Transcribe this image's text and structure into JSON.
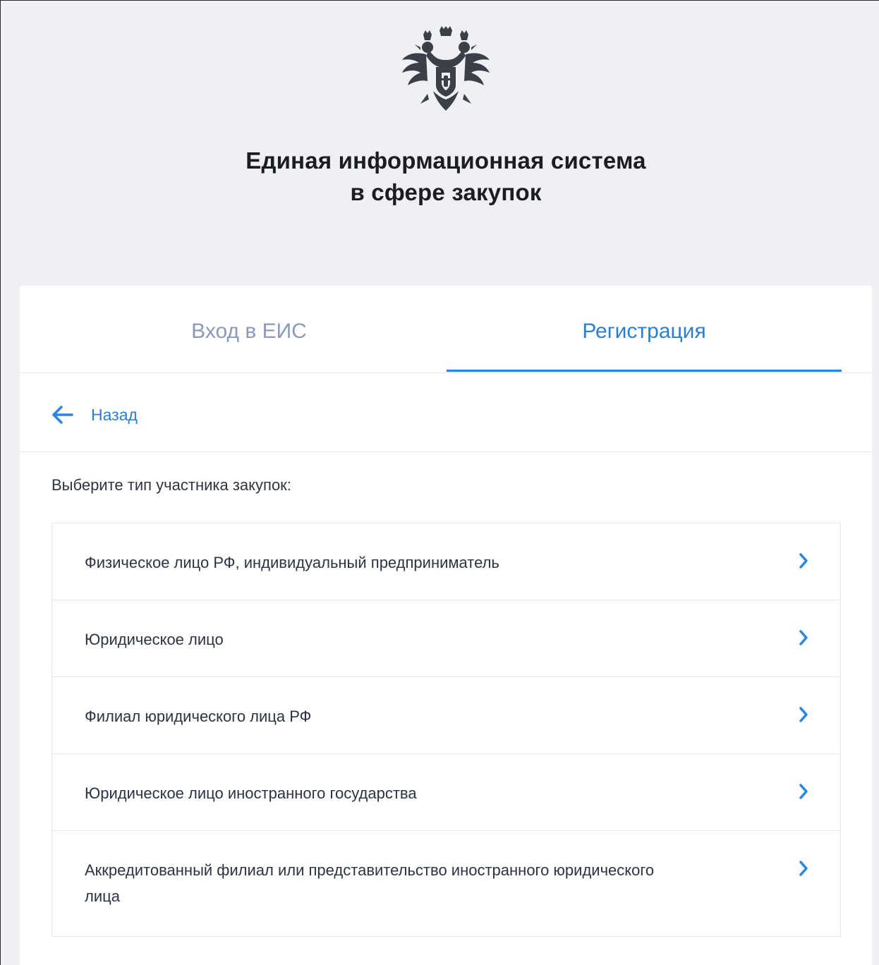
{
  "header": {
    "emblem": "russian-coat-of-arms",
    "title_line1": "Единая информационная система",
    "title_line2": "в сфере закупок"
  },
  "tabs": {
    "login": "Вход в ЕИС",
    "register": "Регистрация",
    "active": "register"
  },
  "back": {
    "label": "Назад",
    "icon": "arrow-left-icon"
  },
  "prompt": "Выберите тип участника закупок:",
  "options": [
    {
      "label": "Физическое лицо РФ, индивидуальный предприниматель",
      "icon": "chevron-right-icon"
    },
    {
      "label": "Юридическое лицо",
      "icon": "chevron-right-icon"
    },
    {
      "label": "Филиал юридического лица РФ",
      "icon": "chevron-right-icon"
    },
    {
      "label": "Юридическое лицо иностранного государства",
      "icon": "chevron-right-icon"
    },
    {
      "label": "Аккредитованный филиал или представительство иностранного юридического лица",
      "icon": "chevron-right-icon"
    }
  ],
  "colors": {
    "accent": "#2a85df",
    "inactive_tab": "#8a9ab8",
    "header_bg": "#eef0f3",
    "text": "#2a3442"
  }
}
